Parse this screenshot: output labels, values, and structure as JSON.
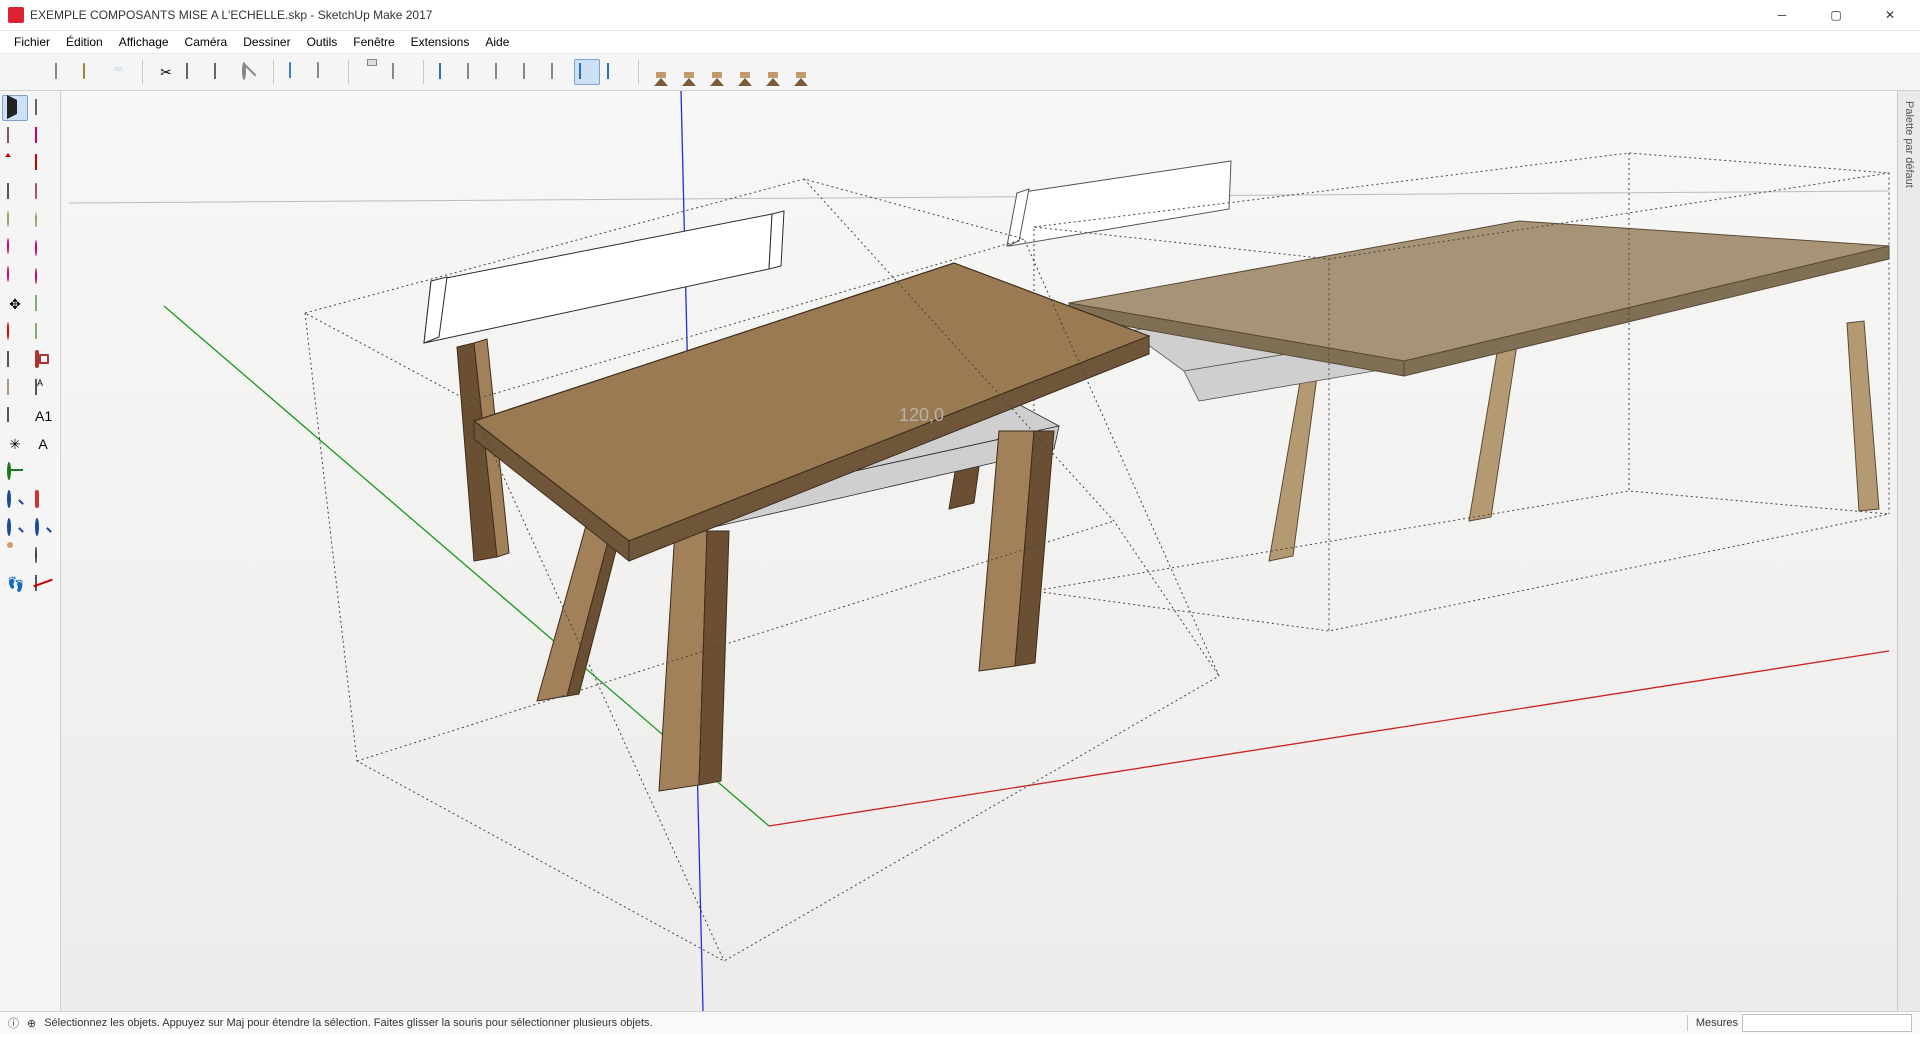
{
  "window": {
    "title": "EXEMPLE COMPOSANTS MISE A L'ECHELLE.skp - SketchUp Make 2017"
  },
  "menu": {
    "items": [
      "Fichier",
      "Édition",
      "Affichage",
      "Caméra",
      "Dessiner",
      "Outils",
      "Fenêtre",
      "Extensions",
      "Aide"
    ]
  },
  "right_panel": {
    "tab_label": "Palette par défaut"
  },
  "status": {
    "hint": "Sélectionnez les objets. Appuyez sur Maj pour étendre la sélection. Faites glisser la souris pour sélectionner plusieurs objets.",
    "measure_label": "Mesures",
    "measure_value": ""
  },
  "viewport": {
    "annotation": "120,0"
  },
  "toolbar_top": [
    {
      "group": [
        {
          "name": "new-file-icon",
          "shape": "newdoc"
        },
        {
          "name": "open-file-icon",
          "shape": "folder"
        },
        {
          "name": "save-file-icon",
          "shape": "disk"
        }
      ]
    },
    {
      "group": [
        {
          "name": "cut-icon",
          "shape": "scissors",
          "glyph": "✂"
        },
        {
          "name": "copy-icon",
          "shape": "sq"
        },
        {
          "name": "paste-icon",
          "shape": "sq"
        },
        {
          "name": "delete-icon",
          "shape": "cancel"
        }
      ]
    },
    {
      "group": [
        {
          "name": "undo-icon",
          "shape": "undo"
        },
        {
          "name": "redo-icon",
          "shape": "redo"
        }
      ]
    },
    {
      "group": [
        {
          "name": "print-icon",
          "shape": "print"
        },
        {
          "name": "model-info-icon",
          "shape": "newdoc"
        }
      ]
    },
    {
      "group": [
        {
          "name": "style-shaded-icon",
          "shape": "cube"
        },
        {
          "name": "style-wire-icon",
          "shape": "cube w"
        },
        {
          "name": "style-hidden-icon",
          "shape": "cube w"
        },
        {
          "name": "style-mono-icon",
          "shape": "cube w"
        },
        {
          "name": "style-xray-icon",
          "shape": "cube w"
        },
        {
          "name": "style-backedges-icon",
          "shape": "cube",
          "pressed": true
        },
        {
          "name": "style-texture-icon",
          "shape": "cube"
        }
      ]
    },
    {
      "group": [
        {
          "name": "warehouse-icon",
          "shape": "house"
        },
        {
          "name": "extension-warehouse-icon",
          "shape": "house"
        },
        {
          "name": "iso-view-icon",
          "shape": "house"
        },
        {
          "name": "top-view-icon",
          "shape": "house"
        },
        {
          "name": "front-view-icon",
          "shape": "house"
        },
        {
          "name": "side-view-icon",
          "shape": "house"
        }
      ]
    }
  ],
  "toolbar_left": [
    [
      {
        "name": "select-tool-icon",
        "shape": "arrow",
        "pressed": true
      },
      {
        "name": "make-component-icon",
        "shape": "sq"
      }
    ],
    [
      {
        "name": "paint-bucket-icon",
        "shape": "bucket"
      },
      {
        "name": "eraser-tool-icon",
        "shape": "eraser"
      }
    ],
    [
      {
        "name": "line-tool-icon",
        "shape": "pencil"
      },
      {
        "name": "freehand-tool-icon",
        "shape": "freehand"
      }
    ],
    [
      {
        "name": "rectangle-tool-icon",
        "shape": "rect"
      },
      {
        "name": "rotated-rectangle-icon",
        "shape": "rrect"
      }
    ],
    [
      {
        "name": "circle-tool-icon",
        "shape": "circ"
      },
      {
        "name": "polygon-tool-icon",
        "shape": "poly"
      }
    ],
    [
      {
        "name": "arc-tool-icon",
        "shape": "arc"
      },
      {
        "name": "two-point-arc-icon",
        "shape": "arc2"
      }
    ],
    [
      {
        "name": "three-point-arc-icon",
        "shape": "arc"
      },
      {
        "name": "pie-tool-icon",
        "shape": "arc2"
      }
    ],
    [
      {
        "name": "move-tool-icon",
        "shape": "move",
        "glyph": "✥"
      },
      {
        "name": "push-pull-tool-icon",
        "shape": "pushpull"
      }
    ],
    [
      {
        "name": "rotate-tool-icon",
        "shape": "rotate"
      },
      {
        "name": "follow-me-tool-icon",
        "shape": "followme"
      }
    ],
    [
      {
        "name": "scale-tool-icon",
        "shape": "scale"
      },
      {
        "name": "offset-tool-icon",
        "shape": "offset"
      }
    ],
    [
      {
        "name": "tape-measure-icon",
        "shape": "tape"
      },
      {
        "name": "dimensions-tool-icon",
        "shape": "tapelbl"
      }
    ],
    [
      {
        "name": "protractor-tool-icon",
        "shape": "protractor"
      },
      {
        "name": "text-tool-icon",
        "shape": "text",
        "glyph": "A1"
      }
    ],
    [
      {
        "name": "axes-tool-icon",
        "shape": "axes",
        "glyph": "✳"
      },
      {
        "name": "3d-text-tool-icon",
        "shape": "text",
        "glyph": "A"
      }
    ],
    [
      {
        "name": "orbit-tool-icon",
        "shape": "orbit"
      },
      {
        "name": "pan-tool-icon",
        "shape": "pan"
      }
    ],
    [
      {
        "name": "zoom-tool-icon",
        "shape": "zoom"
      },
      {
        "name": "zoom-extents-icon",
        "shape": "zoomext"
      }
    ],
    [
      {
        "name": "zoom-window-icon",
        "shape": "zoom"
      },
      {
        "name": "previous-view-icon",
        "shape": "zoom"
      }
    ],
    [
      {
        "name": "position-camera-icon",
        "shape": "person"
      },
      {
        "name": "look-around-icon",
        "shape": "eye"
      }
    ],
    [
      {
        "name": "walk-tool-icon",
        "shape": "feet",
        "glyph": "👣"
      },
      {
        "name": "section-plane-icon",
        "shape": "section"
      }
    ]
  ]
}
